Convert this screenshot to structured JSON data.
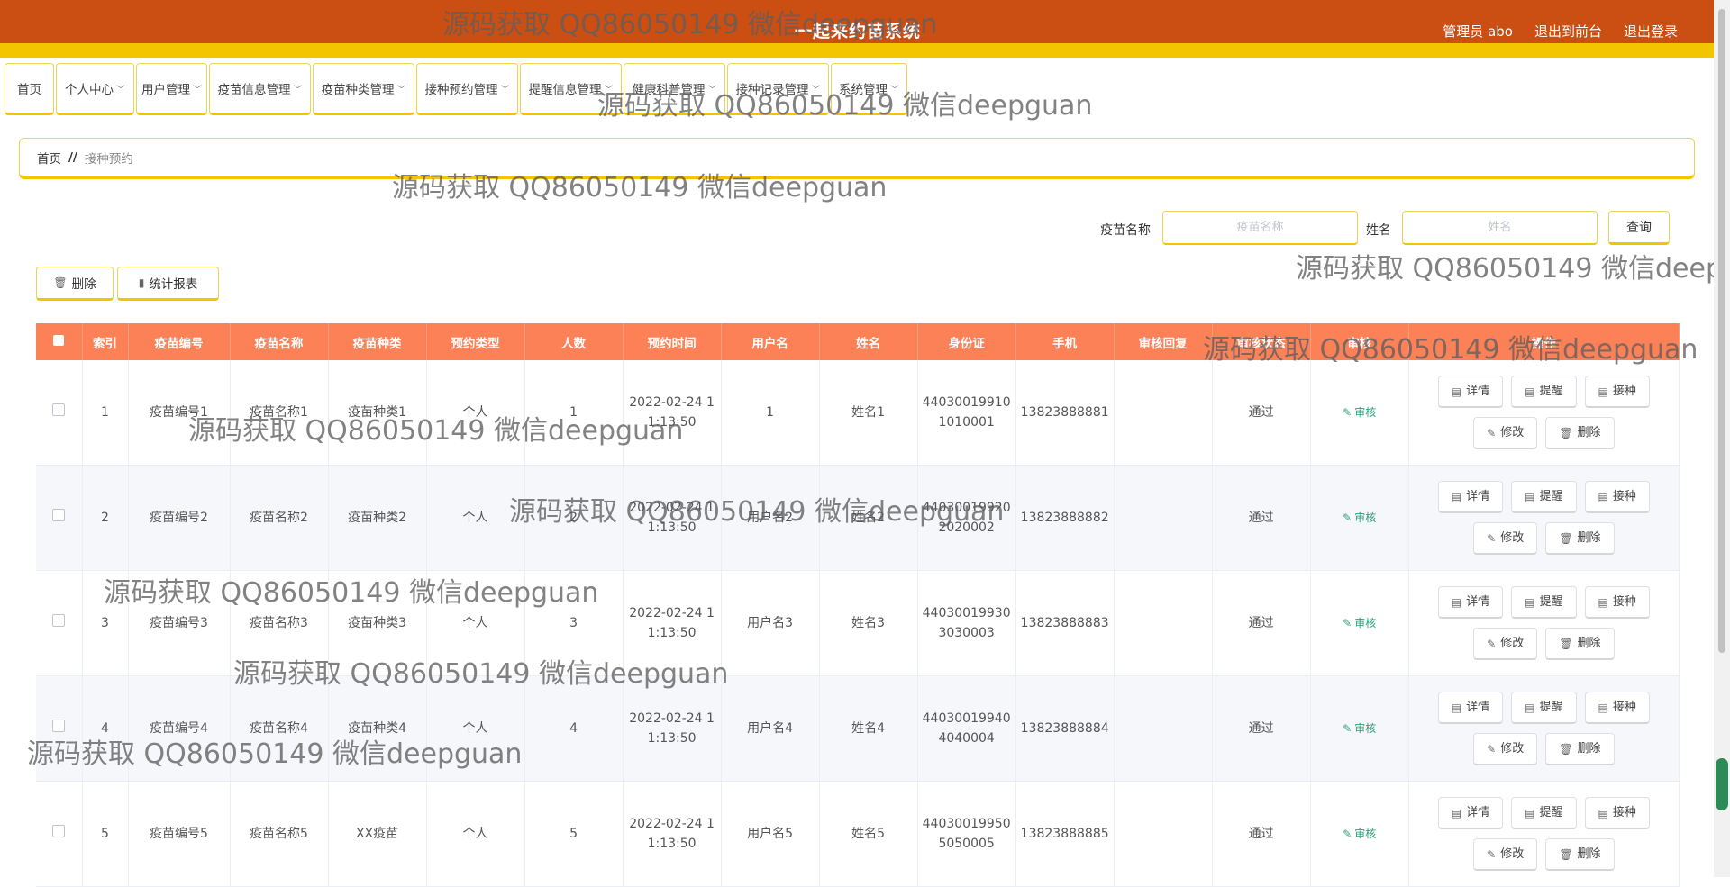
{
  "header": {
    "app_title": "一起来约苗系统",
    "admin_label": "管理员 abo",
    "front_label": "退出到前台",
    "logout_label": "退出登录"
  },
  "menu": [
    {
      "label": "首页",
      "has_arrow": false
    },
    {
      "label": "个人中心",
      "has_arrow": true
    },
    {
      "label": "用户管理",
      "has_arrow": true
    },
    {
      "label": "疫苗信息管理",
      "has_arrow": true
    },
    {
      "label": "疫苗种类管理",
      "has_arrow": true
    },
    {
      "label": "接种预约管理",
      "has_arrow": true
    },
    {
      "label": "提醒信息管理",
      "has_arrow": true
    },
    {
      "label": "健康科普管理",
      "has_arrow": true
    },
    {
      "label": "接种记录管理",
      "has_arrow": true
    },
    {
      "label": "系统管理",
      "has_arrow": true
    }
  ],
  "breadcrumb": {
    "home": "首页",
    "sep": "//",
    "current": "接种预约"
  },
  "search": {
    "vaccine_label": "疫苗名称",
    "vaccine_placeholder": "疫苗名称",
    "name_label": "姓名",
    "name_placeholder": "姓名",
    "query_label": "查询"
  },
  "actions": {
    "delete_label": "删除",
    "report_label": "统计报表"
  },
  "table": {
    "columns": [
      "",
      "索引",
      "疫苗编号",
      "疫苗名称",
      "疫苗种类",
      "预约类型",
      "人数",
      "预约时间",
      "用户名",
      "姓名",
      "身份证",
      "手机",
      "审核回复",
      "审核状态",
      "审核",
      "操作"
    ],
    "audit_label": "审核",
    "op_labels": [
      "详情",
      "提醒",
      "接种",
      "修改",
      "删除"
    ],
    "rows": [
      [
        "1",
        "疫苗编号1",
        "疫苗名称1",
        "疫苗种类1",
        "个人",
        "1",
        "2022-02-24 11:13:50",
        "1",
        "姓名1",
        "440300199101010001",
        "13823888881",
        "",
        "通过"
      ],
      [
        "2",
        "疫苗编号2",
        "疫苗名称2",
        "疫苗种类2",
        "个人",
        "2",
        "2022-02-24 11:13:50",
        "用户名2",
        "姓名2",
        "440300199202020002",
        "13823888882",
        "",
        "通过"
      ],
      [
        "3",
        "疫苗编号3",
        "疫苗名称3",
        "疫苗种类3",
        "个人",
        "3",
        "2022-02-24 11:13:50",
        "用户名3",
        "姓名3",
        "440300199303030003",
        "13823888883",
        "",
        "通过"
      ],
      [
        "4",
        "疫苗编号4",
        "疫苗名称4",
        "疫苗种类4",
        "个人",
        "4",
        "2022-02-24 11:13:50",
        "用户名4",
        "姓名4",
        "440300199404040004",
        "13823888884",
        "",
        "通过"
      ],
      [
        "5",
        "疫苗编号5",
        "疫苗名称5",
        "XX疫苗",
        "个人",
        "5",
        "2022-02-24 11:13:50",
        "用户名5",
        "姓名5",
        "440300199505050005",
        "13823888885",
        "",
        "通过"
      ]
    ]
  },
  "watermark": "源码获取 QQ86050149 微信deepguan",
  "colors": {
    "topbar": "#cb4e12",
    "gold": "#f3c400",
    "table_header": "#fc8157",
    "audit": "#2fa37a"
  }
}
